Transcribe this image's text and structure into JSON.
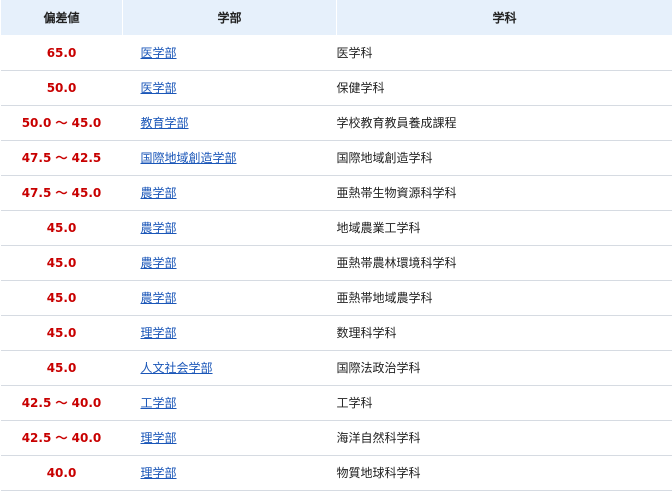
{
  "header": {
    "score_label": "偏差値",
    "faculty_label": "学部",
    "department_label": "学科"
  },
  "rows": [
    {
      "score": "65.0",
      "faculty": "医学部",
      "department": "医学科"
    },
    {
      "score": "50.0",
      "faculty": "医学部",
      "department": "保健学科"
    },
    {
      "score": "50.0 〜 45.0",
      "faculty": "教育学部",
      "department": "学校教育教員養成課程"
    },
    {
      "score": "47.5 〜 42.5",
      "faculty": "国際地域創造学部",
      "department": "国際地域創造学科"
    },
    {
      "score": "47.5 〜 45.0",
      "faculty": "農学部",
      "department": "亜熱帯生物資源科学科"
    },
    {
      "score": "45.0",
      "faculty": "農学部",
      "department": "地域農業工学科"
    },
    {
      "score": "45.0",
      "faculty": "農学部",
      "department": "亜熱帯農林環境科学科"
    },
    {
      "score": "45.0",
      "faculty": "農学部",
      "department": "亜熱帯地域農学科"
    },
    {
      "score": "45.0",
      "faculty": "理学部",
      "department": "数理科学科"
    },
    {
      "score": "45.0",
      "faculty": "人文社会学部",
      "department": "国際法政治学科"
    },
    {
      "score": "42.5 〜 40.0",
      "faculty": "工学部",
      "department": "工学科"
    },
    {
      "score": "42.5 〜 40.0",
      "faculty": "理学部",
      "department": "海洋自然科学科"
    },
    {
      "score": "40.0",
      "faculty": "理学部",
      "department": "物質地球科学科"
    }
  ],
  "colors": {
    "header_bg": "#e6f0fb",
    "score_red": "#c80000",
    "link_blue": "#1a56b8",
    "row_border": "#d6dbe2"
  }
}
